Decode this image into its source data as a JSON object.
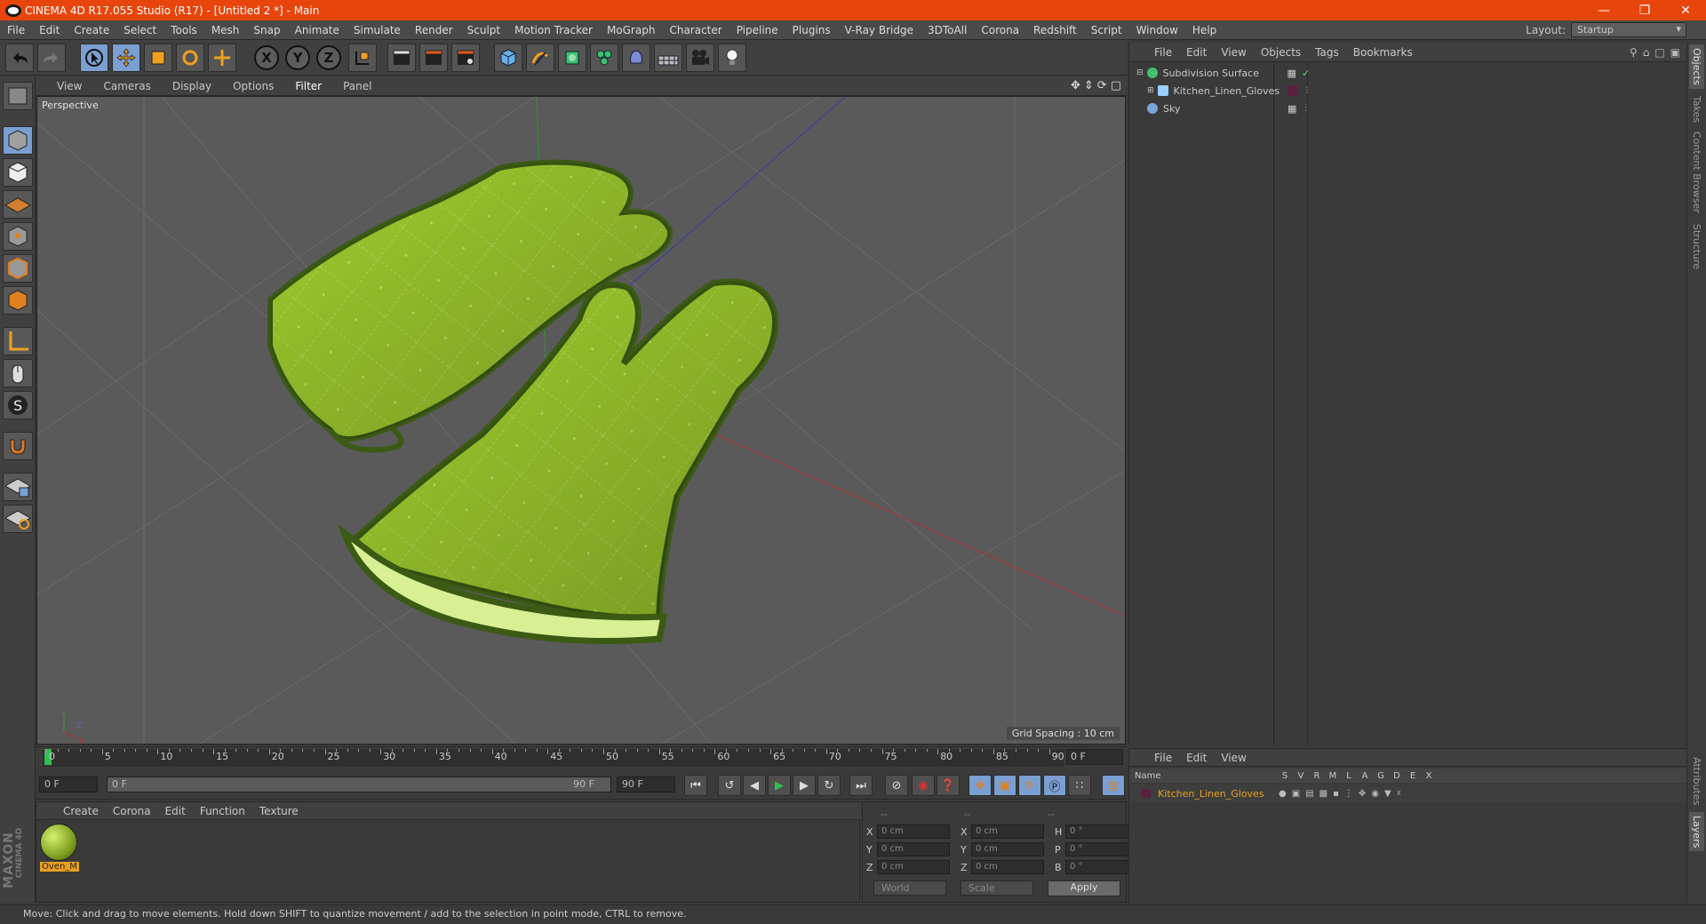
{
  "window": {
    "title": "CINEMA 4D R17.055 Studio (R17) - [Untitled 2 *] - Main"
  },
  "menu": [
    "File",
    "Edit",
    "Create",
    "Select",
    "Tools",
    "Mesh",
    "Snap",
    "Animate",
    "Simulate",
    "Render",
    "Sculpt",
    "Motion Tracker",
    "MoGraph",
    "Character",
    "Pipeline",
    "Plugins",
    "V-Ray Bridge",
    "3DToAll",
    "Corona",
    "Redshift",
    "Script",
    "Window",
    "Help"
  ],
  "layout": {
    "label": "Layout:",
    "value": "Startup"
  },
  "viewport": {
    "menu": [
      "View",
      "Cameras",
      "Display",
      "Options",
      "Filter",
      "Panel"
    ],
    "label": "Perspective",
    "grid_spacing": "Grid Spacing : 10 cm"
  },
  "timeline": {
    "ticks": [
      "0",
      "5",
      "10",
      "15",
      "20",
      "25",
      "30",
      "35",
      "40",
      "45",
      "50",
      "55",
      "60",
      "65",
      "70",
      "75",
      "80",
      "85",
      "90"
    ],
    "current_frame": "0 F",
    "start": "0 F",
    "range_start": "0 F",
    "range_end": "90 F",
    "end": "90 F"
  },
  "materials": {
    "menu": [
      "Create",
      "Corona",
      "Edit",
      "Function",
      "Texture"
    ],
    "items": [
      {
        "name": "Oven_M"
      }
    ]
  },
  "coords": {
    "head": [
      "--",
      "--",
      "--"
    ],
    "rows": [
      {
        "l1": "X",
        "v1": "0 cm",
        "l2": "X",
        "v2": "0 cm",
        "l3": "H",
        "v3": "0 °"
      },
      {
        "l1": "Y",
        "v1": "0 cm",
        "l2": "Y",
        "v2": "0 cm",
        "l3": "P",
        "v3": "0 °"
      },
      {
        "l1": "Z",
        "v1": "0 cm",
        "l2": "Z",
        "v2": "0 cm",
        "l3": "B",
        "v3": "0 °"
      }
    ],
    "mode": "World",
    "size_mode": "Scale",
    "apply": "Apply"
  },
  "objects": {
    "menu": [
      "File",
      "Edit",
      "View",
      "Objects",
      "Tags",
      "Bookmarks"
    ],
    "items": [
      {
        "name": "Subdivision Surface",
        "color": "#44c070"
      },
      {
        "name": "Kitchen_Linen_Gloves",
        "color": "#9ad0ff"
      },
      {
        "name": "Sky",
        "color": "#7aa4d8"
      }
    ]
  },
  "layers": {
    "menu": [
      "File",
      "Edit",
      "View"
    ],
    "columns": [
      "Name",
      "S",
      "V",
      "R",
      "M",
      "L",
      "A",
      "G",
      "D",
      "E",
      "X"
    ],
    "items": [
      {
        "name": "Kitchen_Linen_Gloves",
        "color": "#e8a020"
      }
    ]
  },
  "side_tabs": [
    "Objects",
    "Takes",
    "Content Browser",
    "Structure",
    "Attributes",
    "Layers"
  ],
  "branding": {
    "maxon": "MAXON",
    "c4d": "CINEMA 4D"
  },
  "status": "Move: Click and drag to move elements. Hold down SHIFT to quantize movement / add to the selection in point mode, CTRL to remove."
}
